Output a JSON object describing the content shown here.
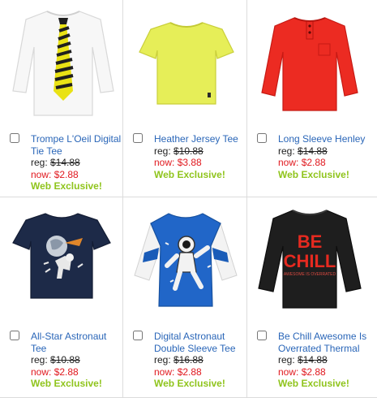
{
  "products": [
    {
      "name": "Trompe L'Oeil Digital Tie Tee",
      "reg_label": "reg:",
      "reg_price": "$14.88",
      "now_label": "now:",
      "now_price": "$2.88",
      "badge": "Web Exclusive!",
      "image": "white-tee-with-striped-tie"
    },
    {
      "name": "Heather Jersey Tee",
      "reg_label": "reg:",
      "reg_price": "$10.88",
      "now_label": "now:",
      "now_price": "$3.88",
      "badge": "Web Exclusive!",
      "image": "yellow-tee"
    },
    {
      "name": "Long Sleeve Henley",
      "reg_label": "reg:",
      "reg_price": "$14.88",
      "now_label": "now:",
      "now_price": "$2.88",
      "badge": "Web Exclusive!",
      "image": "red-henley"
    },
    {
      "name": "All-Star Astronaut Tee",
      "reg_label": "reg:",
      "reg_price": "$10.88",
      "now_label": "now:",
      "now_price": "$2.88",
      "badge": "Web Exclusive!",
      "image": "navy-astronaut-tee"
    },
    {
      "name": "Digital Astronaut Double Sleeve Tee",
      "reg_label": "reg:",
      "reg_price": "$16.88",
      "now_label": "now:",
      "now_price": "$2.88",
      "badge": "Web Exclusive!",
      "image": "blue-astronaut-double-sleeve-tee"
    },
    {
      "name": "Be Chill Awesome Is Overrated Thermal",
      "reg_label": "reg:",
      "reg_price": "$14.88",
      "now_label": "now:",
      "now_price": "$2.88",
      "badge": "Web Exclusive!",
      "image": "black-be-chill-thermal"
    }
  ],
  "graphics": {
    "be_chill_big": "BE CHILL",
    "be_chill_small": "AWESOME IS OVERRATED"
  },
  "colors": {
    "link": "#2a66b8",
    "sale": "#e0181e",
    "badge": "#8fc41c"
  }
}
